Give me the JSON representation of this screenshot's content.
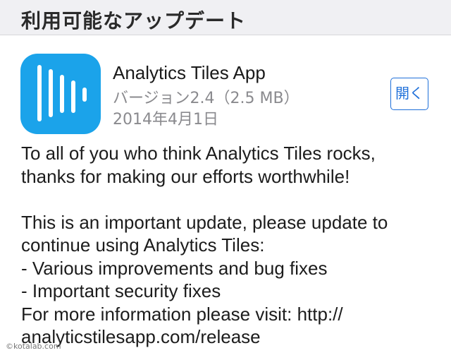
{
  "section": {
    "title": "利用可能なアップデート"
  },
  "app": {
    "icon": "analytics-tiles-app-icon",
    "icon_color": "#1ba3ea",
    "name": "Analytics Tiles App",
    "version": "バージョン2.4（2.5 MB）",
    "date": "2014年4月1日",
    "open_label": "開く",
    "button_color": "#1e6fd9"
  },
  "release_notes": {
    "lines": [
      "To all of you who think Analytics Tiles rocks,",
      "thanks for making our efforts worthwhile!",
      "",
      "This is an important update, please update to",
      "continue using Analytics Tiles:",
      "- Various improvements and bug fixes",
      "- Important security fixes",
      "For more information please visit: http://",
      "analyticstilesapp.com/release"
    ]
  },
  "watermark": "©kotalab.com"
}
